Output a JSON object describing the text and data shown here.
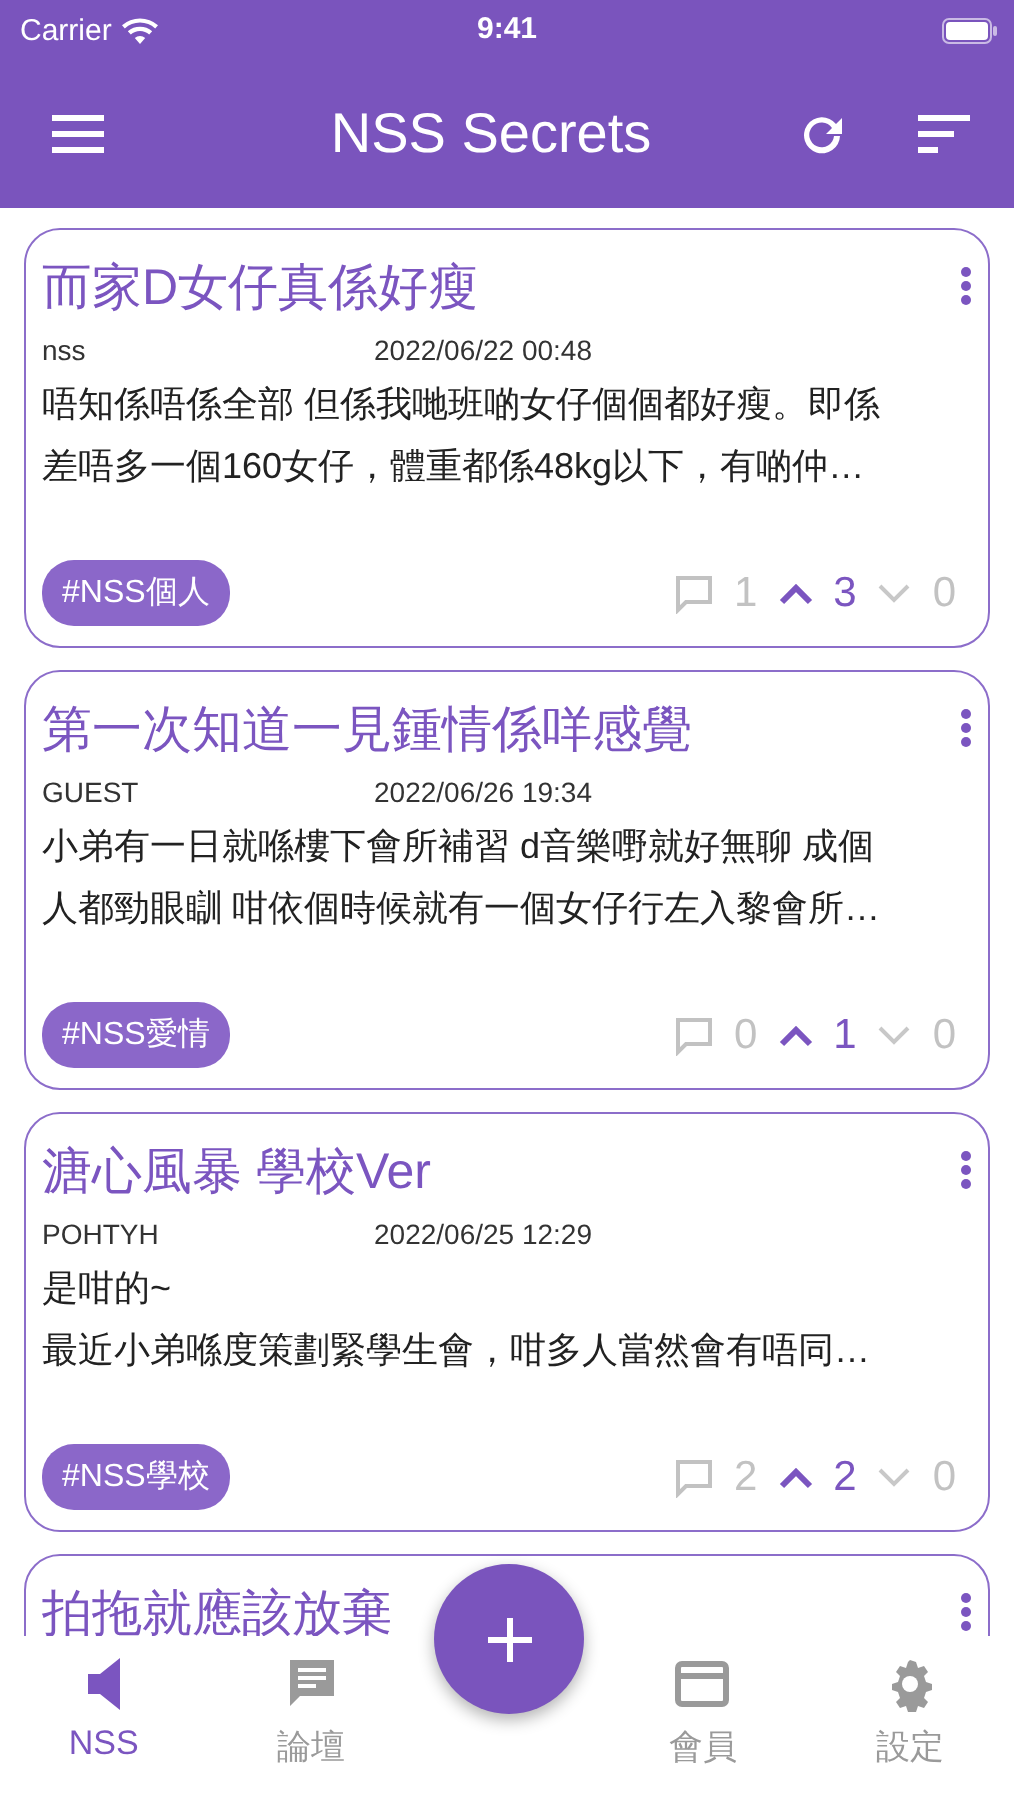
{
  "status_bar": {
    "carrier": "Carrier",
    "time": "9:41"
  },
  "nav_bar": {
    "title": "NSS Secrets"
  },
  "posts": [
    {
      "title": "而家D女仔真係好瘦",
      "author": "nss",
      "date": "2022/06/22 00:48",
      "body_lines": [
        "唔知係唔係全部 但係我哋班啲女仔個個都好瘦。即係",
        "差唔多一個160女仔，體重都係48kg以下，有啲仲…"
      ],
      "tag": "#NSS個人",
      "comments": "1",
      "upvotes": "3",
      "downvotes": "0"
    },
    {
      "title": "第一次知道一見鍾情係咩感覺",
      "author": "GUEST",
      "date": "2022/06/26 19:34",
      "body_lines": [
        "小弟有一日就喺樓下會所補習 d音樂嘢就好無聊 成個",
        "人都勁眼瞓 咁依個時候就有一個女仔行左入黎會所…"
      ],
      "tag": "#NSS愛情",
      "comments": "0",
      "upvotes": "1",
      "downvotes": "0"
    },
    {
      "title": "溏心風暴 學校Ver",
      "author": "POHTYH",
      "date": "2022/06/25 12:29",
      "body_lines": [
        "是咁的~",
        "最近小弟喺度策劃緊學生會，咁多人當然會有唔同…"
      ],
      "tag": "#NSS學校",
      "comments": "2",
      "upvotes": "2",
      "downvotes": "0"
    },
    {
      "title": "拍拖就應該放棄"
    }
  ],
  "tab_bar": [
    {
      "kind": "speaker",
      "label": "NSS",
      "selected": true
    },
    {
      "kind": "forum",
      "label": "論壇",
      "selected": false
    },
    {
      "kind": "spacer"
    },
    {
      "kind": "card",
      "label": "會員",
      "selected": false
    },
    {
      "kind": "gear",
      "label": "設定",
      "selected": false
    }
  ]
}
